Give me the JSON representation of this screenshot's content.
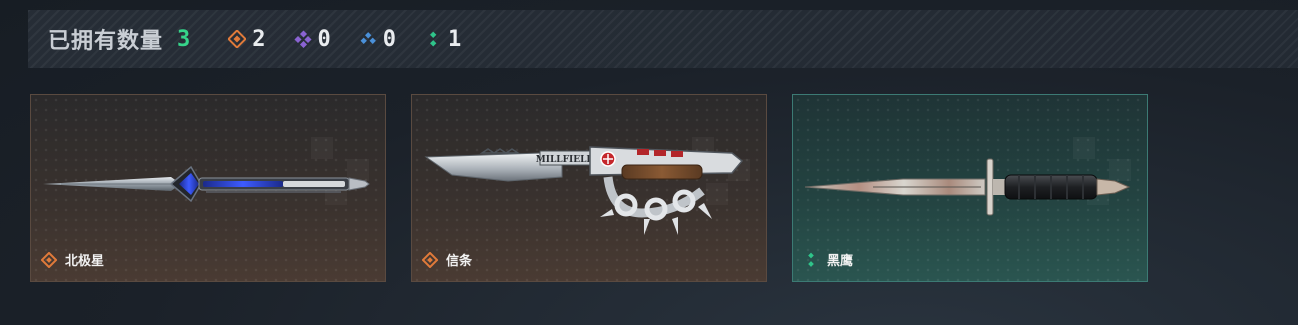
{
  "header": {
    "title": "已拥有数量",
    "total": "3",
    "stats": [
      {
        "icon": "orange-diamond-rarity-icon",
        "color": "#e07a3a",
        "count": "2"
      },
      {
        "icon": "purple-diamond-rarity-icon",
        "color": "#8a63d2",
        "count": "0"
      },
      {
        "icon": "blue-diamond-rarity-icon",
        "color": "#4a90d9",
        "count": "0"
      },
      {
        "icon": "green-dots-rarity-icon",
        "color": "#2fc48a",
        "count": "1"
      }
    ]
  },
  "cards": [
    {
      "name": "北极星",
      "rarity_icon": "orange-diamond-rarity-icon",
      "rarity_color": "#e07a3a",
      "weapon_icon": "dagger-image"
    },
    {
      "name": "信条",
      "rarity_icon": "orange-diamond-rarity-icon",
      "rarity_color": "#e07a3a",
      "weapon_icon": "knuckle-knife-image",
      "engraving": "MILLFIELD"
    },
    {
      "name": "黑鹰",
      "rarity_icon": "green-dots-rarity-icon",
      "rarity_color": "#2fc48a",
      "weapon_icon": "bayonet-knife-image"
    }
  ]
}
